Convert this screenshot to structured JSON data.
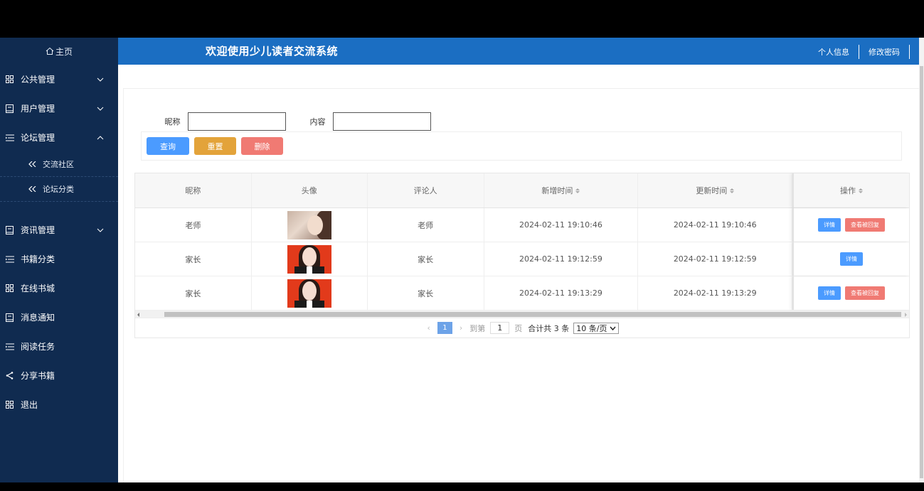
{
  "sidebar": {
    "home_label": "主页",
    "items": [
      {
        "label": "公共管理",
        "icon": "grid-icon",
        "chevron": "down"
      },
      {
        "label": "用户管理",
        "icon": "book-icon",
        "chevron": "down"
      },
      {
        "label": "论坛管理",
        "icon": "list-icon",
        "chevron": "up"
      }
    ],
    "subitems": [
      {
        "label": "交流社区",
        "icon": "double-arrow-left-icon"
      },
      {
        "label": "论坛分类",
        "icon": "double-arrow-left-icon"
      }
    ],
    "items2": [
      {
        "label": "资讯管理",
        "icon": "book-icon",
        "chevron": "down"
      },
      {
        "label": "书籍分类",
        "icon": "list-icon"
      },
      {
        "label": "在线书城",
        "icon": "grid-icon"
      },
      {
        "label": "消息通知",
        "icon": "book-icon"
      },
      {
        "label": "阅读任务",
        "icon": "list-icon"
      },
      {
        "label": "分享书籍",
        "icon": "share-icon"
      },
      {
        "label": "退出",
        "icon": "grid-icon"
      }
    ]
  },
  "header": {
    "title": "欢迎使用少儿读者交流系统",
    "profile_link": "个人信息",
    "password_link": "修改密码"
  },
  "search": {
    "nickname_label": "昵称",
    "content_label": "内容",
    "nickname_value": "",
    "content_value": ""
  },
  "actions": {
    "query": "查询",
    "reset": "重置",
    "delete": "删除"
  },
  "table": {
    "columns": [
      "昵称",
      "头像",
      "评论人",
      "新增时间",
      "更新时间",
      "操作"
    ],
    "rows": [
      {
        "nickname": "老师",
        "commenter": "老师",
        "created": "2024-02-11 19:10:46",
        "updated": "2024-02-11 19:10:46",
        "actions": [
          "详情",
          "查看被回复"
        ]
      },
      {
        "nickname": "家长",
        "commenter": "家长",
        "created": "2024-02-11 19:12:59",
        "updated": "2024-02-11 19:12:59",
        "actions": [
          "详情"
        ]
      },
      {
        "nickname": "家长",
        "commenter": "家长",
        "created": "2024-02-11 19:13:29",
        "updated": "2024-02-11 19:13:29",
        "actions": [
          "详情",
          "查看被回复"
        ]
      }
    ]
  },
  "pagination": {
    "current_page": "1",
    "goto_label": "到第",
    "goto_value": "1",
    "page_suffix": "页",
    "total": "合计共 3 条",
    "page_size": "10 条/页"
  },
  "colors": {
    "sidebar_bg": "#102b50",
    "header_bg": "#1b6ec2",
    "primary": "#4b9bff",
    "warning": "#e3a33a",
    "danger": "#f07a73"
  }
}
